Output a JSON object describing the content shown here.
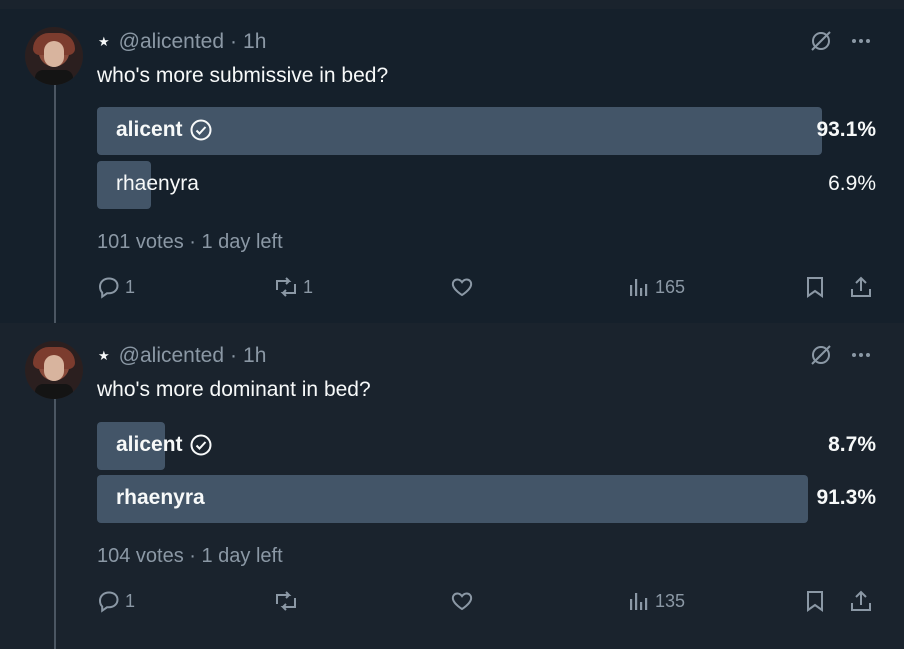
{
  "posts": [
    {
      "handle": "@alicented",
      "time": "1h",
      "question": "who's more submissive in bed?",
      "options": [
        {
          "label": "alicent",
          "percent_text": "93.1%",
          "percent": 93.1,
          "selected": true
        },
        {
          "label": "rhaenyra",
          "percent_text": "6.9%",
          "percent": 6.9,
          "selected": false
        }
      ],
      "votes_text": "101 votes · 1 day left",
      "replies": "1",
      "reposts": "1",
      "likes": "",
      "views": "165"
    },
    {
      "handle": "@alicented",
      "time": "1h",
      "question": "who's more dominant in bed?",
      "options": [
        {
          "label": "alicent",
          "percent_text": "8.7%",
          "percent": 8.7,
          "selected": true
        },
        {
          "label": "rhaenyra",
          "percent_text": "91.3%",
          "percent": 91.3,
          "selected": false
        }
      ],
      "votes_text": "104 votes · 1 day left",
      "replies": "1",
      "reposts": "",
      "likes": "",
      "views": "135"
    }
  ],
  "icons": {
    "star": "star-icon",
    "grok": "grok-icon",
    "more": "more-icon",
    "check": "check-circle-icon",
    "reply": "reply-icon",
    "repost": "repost-icon",
    "like": "heart-icon",
    "views": "views-icon",
    "bookmark": "bookmark-icon",
    "share": "share-icon"
  },
  "colors": {
    "background": "#15202b",
    "bar": "#435568",
    "muted": "#8b98a5",
    "text": "#f7f9f9"
  }
}
